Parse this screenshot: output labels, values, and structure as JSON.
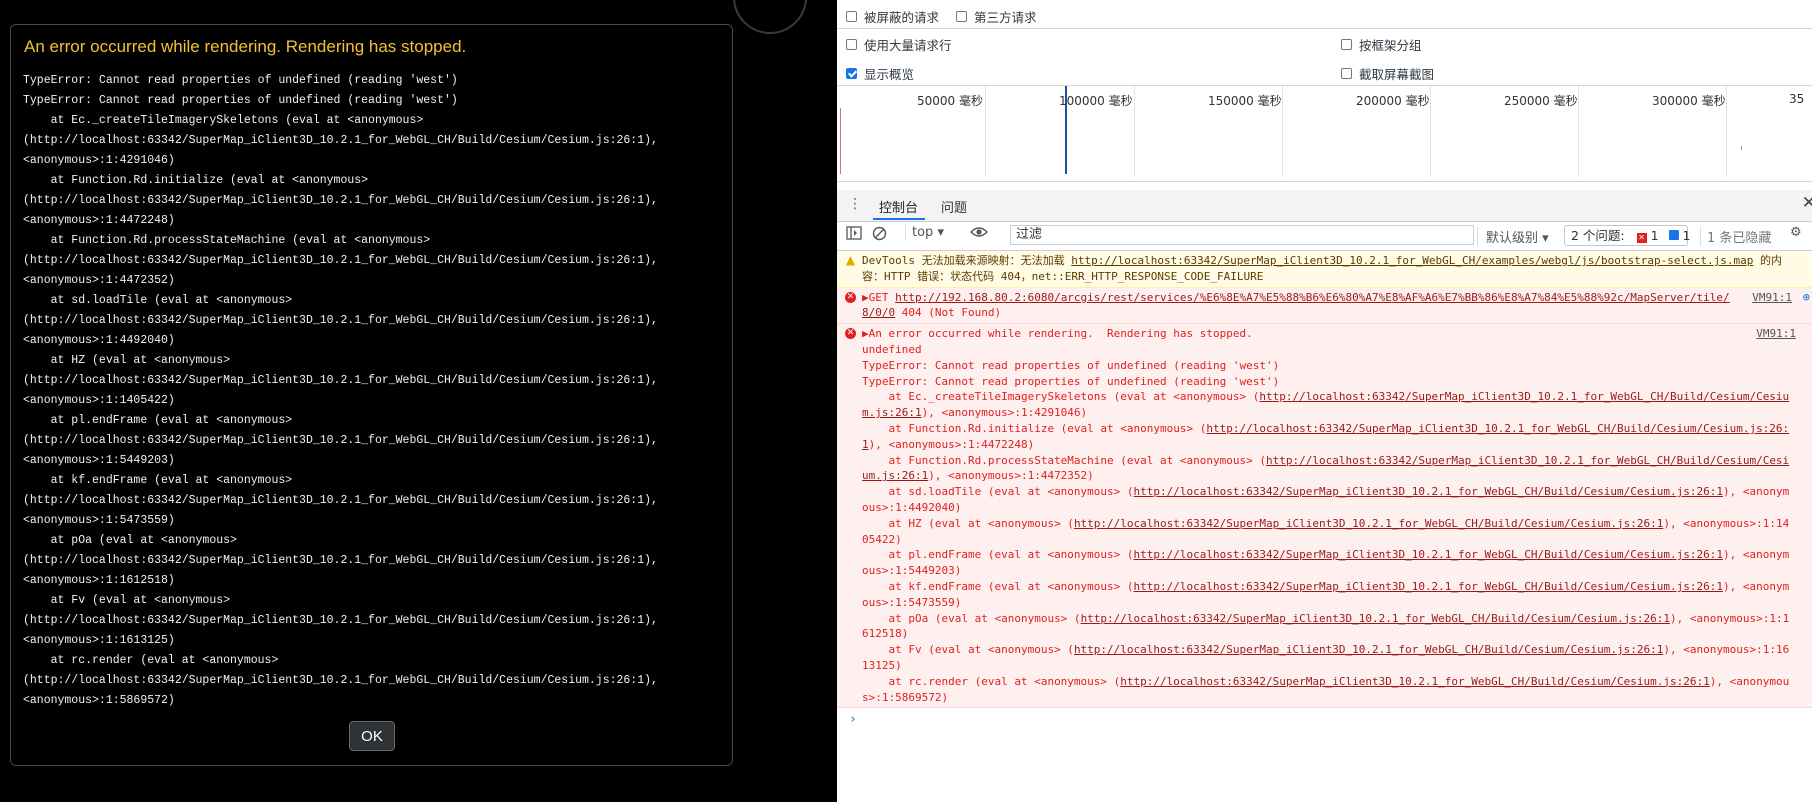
{
  "dialog": {
    "title": "An error occurred while rendering. Rendering has stopped.",
    "body": "TypeError: Cannot read properties of undefined (reading 'west')\nTypeError: Cannot read properties of undefined (reading 'west')\n    at Ec._createTileImagerySkeletons (eval at <anonymous>\n(http://localhost:63342/SuperMap_iClient3D_10.2.1_for_WebGL_CH/Build/Cesium/Cesium.js:26:1),\n<anonymous>:1:4291046)\n    at Function.Rd.initialize (eval at <anonymous>\n(http://localhost:63342/SuperMap_iClient3D_10.2.1_for_WebGL_CH/Build/Cesium/Cesium.js:26:1),\n<anonymous>:1:4472248)\n    at Function.Rd.processStateMachine (eval at <anonymous>\n(http://localhost:63342/SuperMap_iClient3D_10.2.1_for_WebGL_CH/Build/Cesium/Cesium.js:26:1),\n<anonymous>:1:4472352)\n    at sd.loadTile (eval at <anonymous>\n(http://localhost:63342/SuperMap_iClient3D_10.2.1_for_WebGL_CH/Build/Cesium/Cesium.js:26:1),\n<anonymous>:1:4492040)\n    at HZ (eval at <anonymous>\n(http://localhost:63342/SuperMap_iClient3D_10.2.1_for_WebGL_CH/Build/Cesium/Cesium.js:26:1),\n<anonymous>:1:1405422)\n    at pl.endFrame (eval at <anonymous>\n(http://localhost:63342/SuperMap_iClient3D_10.2.1_for_WebGL_CH/Build/Cesium/Cesium.js:26:1),\n<anonymous>:1:5449203)\n    at kf.endFrame (eval at <anonymous>\n(http://localhost:63342/SuperMap_iClient3D_10.2.1_for_WebGL_CH/Build/Cesium/Cesium.js:26:1),\n<anonymous>:1:5473559)\n    at pOa (eval at <anonymous>\n(http://localhost:63342/SuperMap_iClient3D_10.2.1_for_WebGL_CH/Build/Cesium/Cesium.js:26:1),\n<anonymous>:1:1612518)\n    at Fv (eval at <anonymous>\n(http://localhost:63342/SuperMap_iClient3D_10.2.1_for_WebGL_CH/Build/Cesium/Cesium.js:26:1),\n<anonymous>:1:1613125)\n    at rc.render (eval at <anonymous>\n(http://localhost:63342/SuperMap_iClient3D_10.2.1_for_WebGL_CH/Build/Cesium/Cesium.js:26:1),\n<anonymous>:1:5869572)",
    "ok_label": "OK"
  },
  "network_options": {
    "blocked_requests": "被屏蔽的请求",
    "third_party_requests": "第三方请求",
    "large_rows": "使用大量请求行",
    "group_by_frame": "按框架分组",
    "show_overview": "显示概览",
    "capture_screenshots": "截取屏幕截图",
    "show_overview_checked": true
  },
  "timeline": {
    "ticks": [
      "50000 毫秒",
      "100000 毫秒",
      "150000 毫秒",
      "200000 毫秒",
      "250000 毫秒",
      "300000 毫秒",
      "35"
    ]
  },
  "panel_tabs": {
    "console": "控制台",
    "issues": "问题"
  },
  "toolbar": {
    "context": "top",
    "filter_placeholder": "过滤",
    "levels": "默认级别",
    "issues_label": "2 个问题:",
    "issues_errors": "1",
    "issues_info": "1",
    "hidden_count": "1 条已隐藏"
  },
  "console": {
    "warning": {
      "prefix": "DevTools 无法加载来源映射：无法加载 ",
      "url": "http://localhost:63342/SuperMap_iClient3D_10.2.1_for_WebGL_CH/examples/webgl/js/bootstrap-select.js.map",
      "suffix": " 的内容：HTTP 错误：状态代码 404，net::ERR_HTTP_RESPONSE_CODE_FAILURE"
    },
    "get_error": {
      "prefix": "▶GET ",
      "url": "http://192.168.80.2:6080/arcgis/rest/services/%E6%8E%A7%E5%88%B6%E6%80%A7%E8%AF%A6%E7%BB%86%E8%A7%84%E5%88%92c/MapServer/tile/8/0/0",
      "suffix": " 404 (Not Found)",
      "source": "VM91:1"
    },
    "render_error": {
      "head": "▶An error occurred while rendering.  Rendering has stopped.\nundefined\nTypeError: Cannot read properties of undefined (reading 'west')\nTypeError: Cannot read properties of undefined (reading 'west')",
      "source": "VM91:1",
      "frames": [
        {
          "pre": "    at Ec._createTileImagerySkeletons (eval at <anonymous> (",
          "url": "http://localhost:63342/SuperMap_iClient3D_10.2.1_for_WebGL_CH/Build/Cesium/Cesium.js:26:1",
          "post": "), <anonymous>:1:4291046)"
        },
        {
          "pre": "    at Function.Rd.initialize (eval at <anonymous> (",
          "url": "http://localhost:63342/SuperMap_iClient3D_10.2.1_for_WebGL_CH/Build/Cesium/Cesium.js:26:1",
          "post": "), <anonymous>:1:4472248)"
        },
        {
          "pre": "    at Function.Rd.processStateMachine (eval at <anonymous> (",
          "url": "http://localhost:63342/SuperMap_iClient3D_10.2.1_for_WebGL_CH/Build/Cesium/Cesium.js:26:1",
          "post": "), <anonymous>:1:4472352)"
        },
        {
          "pre": "    at sd.loadTile (eval at <anonymous> (",
          "url": "http://localhost:63342/SuperMap_iClient3D_10.2.1_for_WebGL_CH/Build/Cesium/Cesium.js:26:1",
          "post": "), <anonymous>:1:4492040)"
        },
        {
          "pre": "    at HZ (eval at <anonymous> (",
          "url": "http://localhost:63342/SuperMap_iClient3D_10.2.1_for_WebGL_CH/Build/Cesium/Cesium.js:26:1",
          "post": "), <anonymous>:1:1405422)"
        },
        {
          "pre": "    at pl.endFrame (eval at <anonymous> (",
          "url": "http://localhost:63342/SuperMap_iClient3D_10.2.1_for_WebGL_CH/Build/Cesium/Cesium.js:26:1",
          "post": "), <anonymous>:1:5449203)"
        },
        {
          "pre": "    at kf.endFrame (eval at <anonymous> (",
          "url": "http://localhost:63342/SuperMap_iClient3D_10.2.1_for_WebGL_CH/Build/Cesium/Cesium.js:26:1",
          "post": "), <anonymous>:1:5473559)"
        },
        {
          "pre": "    at pOa (eval at <anonymous> (",
          "url": "http://localhost:63342/SuperMap_iClient3D_10.2.1_for_WebGL_CH/Build/Cesium/Cesium.js:26:1",
          "post": "), <anonymous>:1:1612518)"
        },
        {
          "pre": "    at Fv (eval at <anonymous> (",
          "url": "http://localhost:63342/SuperMap_iClient3D_10.2.1_for_WebGL_CH/Build/Cesium/Cesium.js:26:1",
          "post": "), <anonymous>:1:1613125)"
        },
        {
          "pre": "    at rc.render (eval at <anonymous> (",
          "url": "http://localhost:63342/SuperMap_iClient3D_10.2.1_for_WebGL_CH/Build/Cesium/Cesium.js:26:1",
          "post": "), <anonymous>:1:5869572)"
        }
      ]
    },
    "prompt": "›"
  }
}
